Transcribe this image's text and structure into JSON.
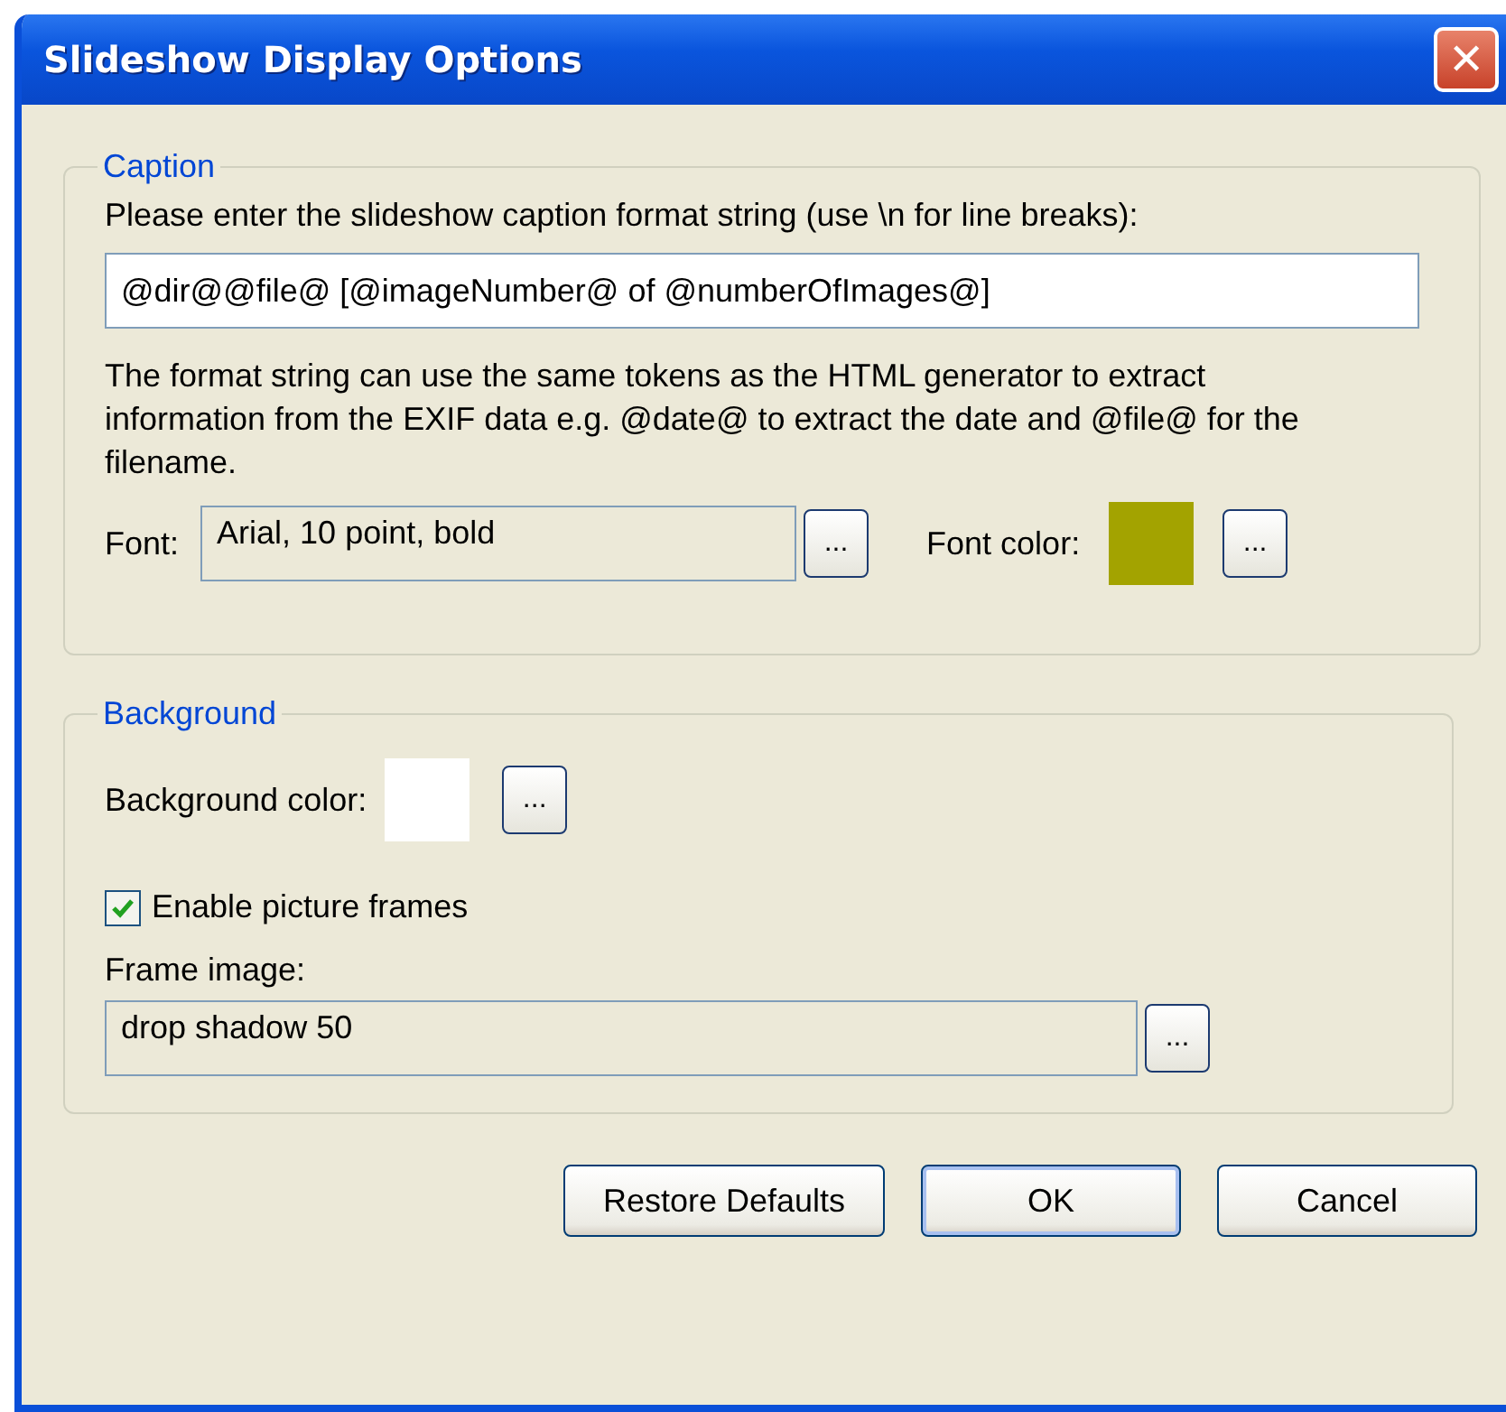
{
  "window": {
    "title": "Slideshow Display Options",
    "close_label": "✕"
  },
  "caption": {
    "legend": "Caption",
    "prompt": "Please enter the slideshow caption format string (use \\n for line breaks):",
    "format_value": "@dir@@file@ [@imageNumber@ of @numberOfImages@]",
    "description": "The format string can use the same tokens as the HTML generator to extract information from the EXIF data e.g. @date@ to extract the date and @file@ for the filename.",
    "font_label": "Font:",
    "font_value": "Arial, 10 point, bold",
    "font_button": "...",
    "font_color": {
      "label": "Font color:",
      "color": "#a3a300",
      "button": "..."
    }
  },
  "background": {
    "legend": "Background",
    "bg_color": {
      "label": "Background color:",
      "color": "#ffffff",
      "button": "..."
    },
    "frames_checkbox": {
      "label": "Enable picture frames",
      "checked": true
    },
    "frame_label": "Frame image:",
    "frame_value": "drop shadow 50",
    "frame_button": "..."
  },
  "buttons": [
    {
      "label": "Restore Defaults",
      "default": false
    },
    {
      "label": "OK",
      "default": true
    },
    {
      "label": "Cancel",
      "default": false
    }
  ]
}
